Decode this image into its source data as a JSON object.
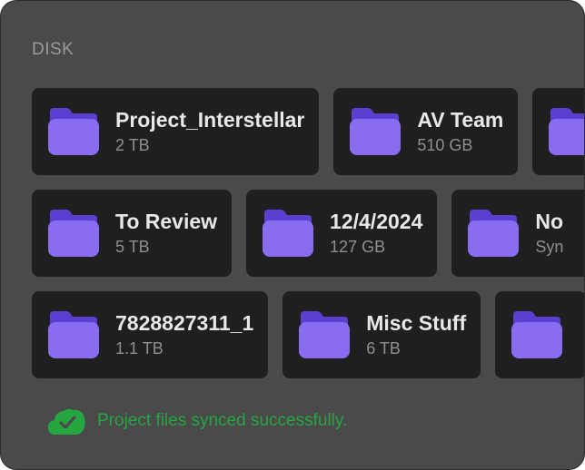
{
  "section": {
    "label": "DISK"
  },
  "colors": {
    "panel_bg": "#4a4a4a",
    "card_bg": "#1f1f1f",
    "folder_front": "#8a6cf0",
    "folder_back": "#5b3fd0",
    "success": "#26a641"
  },
  "rows": [
    [
      {
        "name": "Project_Interstellar",
        "size": "2 TB",
        "icon": "folder-icon"
      },
      {
        "name": "AV Team",
        "size": "510 GB",
        "icon": "folder-icon"
      },
      {
        "name": "",
        "size": "",
        "icon": "folder-icon"
      }
    ],
    [
      {
        "name": "To Review",
        "size": "5 TB",
        "icon": "folder-icon"
      },
      {
        "name": "12/4/2024",
        "size": "127 GB",
        "icon": "folder-icon"
      },
      {
        "name": "No",
        "size": "Syn",
        "icon": "folder-icon"
      }
    ],
    [
      {
        "name": "7828827311_1",
        "size": "1.1 TB",
        "icon": "folder-icon"
      },
      {
        "name": "Misc Stuff",
        "size": "6 TB",
        "icon": "folder-icon"
      },
      {
        "name": "",
        "size": "",
        "icon": "folder-icon"
      }
    ]
  ],
  "status": {
    "text": "Project files synced successfully.",
    "icon": "cloud-check-icon"
  }
}
